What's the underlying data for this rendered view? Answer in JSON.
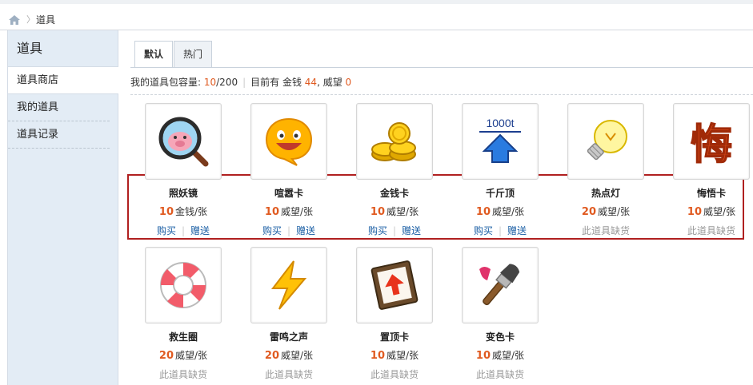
{
  "breadcrumb": {
    "home_icon": "home-icon",
    "current": "道具"
  },
  "sidebar": {
    "title": "道具",
    "items": [
      {
        "label": "道具商店"
      },
      {
        "label": "我的道具"
      },
      {
        "label": "道具记录"
      }
    ]
  },
  "tabs": [
    {
      "label": "默认"
    },
    {
      "label": "热门"
    }
  ],
  "info": {
    "capacity_label": "我的道具包容量: ",
    "capacity_used": "10",
    "capacity_total": "/200",
    "have_label": "目前有 金钱 ",
    "money": "44",
    "prestige_label": ", 威望 ",
    "prestige": "0"
  },
  "items": [
    {
      "name": "照妖镜",
      "price": "10",
      "unit": "金钱/张",
      "buy": "购买",
      "gift": "赠送",
      "icon": "magnifier-pig-icon"
    },
    {
      "name": "喧嚣卡",
      "price": "10",
      "unit": "威望/张",
      "buy": "购买",
      "gift": "赠送",
      "icon": "smiley-bubble-icon"
    },
    {
      "name": "金钱卡",
      "price": "10",
      "unit": "威望/张",
      "buy": "购买",
      "gift": "赠送",
      "icon": "gold-coins-icon"
    },
    {
      "name": "千斤顶",
      "price": "10",
      "unit": "威望/张",
      "buy": "购买",
      "gift": "赠送",
      "icon": "up-arrow-1000t-icon",
      "icon_text": "1000t"
    },
    {
      "name": "热点灯",
      "price": "20",
      "unit": "威望/张",
      "out": "此道具缺货",
      "icon": "light-bulb-icon"
    },
    {
      "name": "悔悟卡",
      "price": "10",
      "unit": "威望/张",
      "out": "此道具缺货",
      "icon": "regret-character-icon",
      "icon_text": "悔"
    },
    {
      "name": "救生圈",
      "price": "20",
      "unit": "威望/张",
      "out": "此道具缺货",
      "icon": "life-ring-icon"
    },
    {
      "name": "雷鸣之声",
      "price": "20",
      "unit": "威望/张",
      "out": "此道具缺货",
      "icon": "lightning-icon"
    },
    {
      "name": "置顶卡",
      "price": "10",
      "unit": "威望/张",
      "out": "此道具缺货",
      "icon": "pin-top-card-icon"
    },
    {
      "name": "变色卡",
      "price": "10",
      "unit": "威望/张",
      "out": "此道具缺货",
      "icon": "paint-brush-icon"
    }
  ],
  "colors": {
    "accent": "#e05a20",
    "link": "#1b5fa5",
    "highlight_box": "#b02020",
    "sidebar_bg": "#e3ecf5"
  }
}
